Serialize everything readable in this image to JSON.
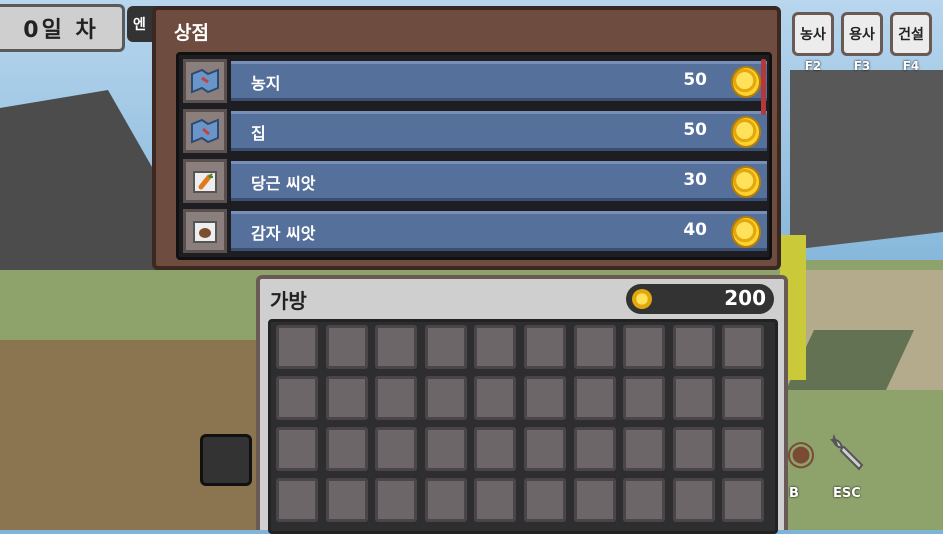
{
  "hud": {
    "day_label": "0일 차",
    "chip_label": "엔"
  },
  "modes": [
    {
      "label": "농사",
      "key": "F2"
    },
    {
      "label": "용사",
      "key": "F3"
    },
    {
      "label": "건설",
      "key": "F4"
    }
  ],
  "shop": {
    "title": "상점",
    "items": [
      {
        "name": "농지",
        "price": "50",
        "icon": "farmland-map-icon"
      },
      {
        "name": "집",
        "price": "50",
        "icon": "house-map-icon"
      },
      {
        "name": "당근 씨앗",
        "price": "30",
        "icon": "carrot-seed-icon"
      },
      {
        "name": "감자 씨앗",
        "price": "40",
        "icon": "potato-seed-icon"
      }
    ]
  },
  "bag": {
    "title": "가방",
    "gold": "200",
    "rows": 4,
    "cols": 10
  },
  "toolbar": {
    "bag_key": "B",
    "settings_key": "ESC"
  },
  "colors": {
    "shop_bg": "#6e4c3f",
    "row_bg": "#56709c",
    "coin": "#ffd32e",
    "bag_bg": "#cfcfcf"
  }
}
